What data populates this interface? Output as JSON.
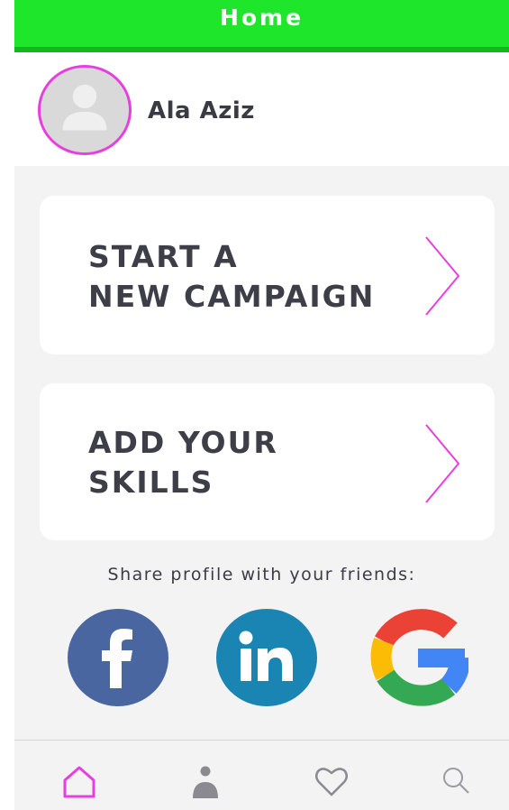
{
  "header": {
    "title": "Home"
  },
  "profile": {
    "name": "Ala Aziz",
    "avatar_icon": "default-user-avatar"
  },
  "cards": [
    {
      "line1": "START A",
      "line2": "NEW CAMPAIGN",
      "icon": "chevron-right-icon"
    },
    {
      "line1": "ADD YOUR",
      "line2": "SKILLS",
      "icon": "chevron-right-icon"
    }
  ],
  "share": {
    "label": "Share profile with your friends:",
    "networks": [
      {
        "name": "facebook",
        "icon": "facebook-icon",
        "color": "#4a66a0"
      },
      {
        "name": "linkedin",
        "icon": "linkedin-icon",
        "color": "#1a84b2"
      },
      {
        "name": "google",
        "icon": "google-icon",
        "colors": [
          "#ea4335",
          "#fbbc05",
          "#34a853",
          "#4285f4"
        ]
      }
    ]
  },
  "bottom_nav": [
    {
      "name": "home",
      "icon": "home-icon",
      "active": true
    },
    {
      "name": "profile",
      "icon": "person-icon",
      "active": false
    },
    {
      "name": "favorites",
      "icon": "heart-icon",
      "active": false
    },
    {
      "name": "search",
      "icon": "search-icon",
      "active": false
    }
  ],
  "colors": {
    "accent": "#e83ee0",
    "topbar": "#1ee62a",
    "topbar_shadow": "#14b81e",
    "background": "#f3f3f4",
    "text": "#3e3e48"
  }
}
